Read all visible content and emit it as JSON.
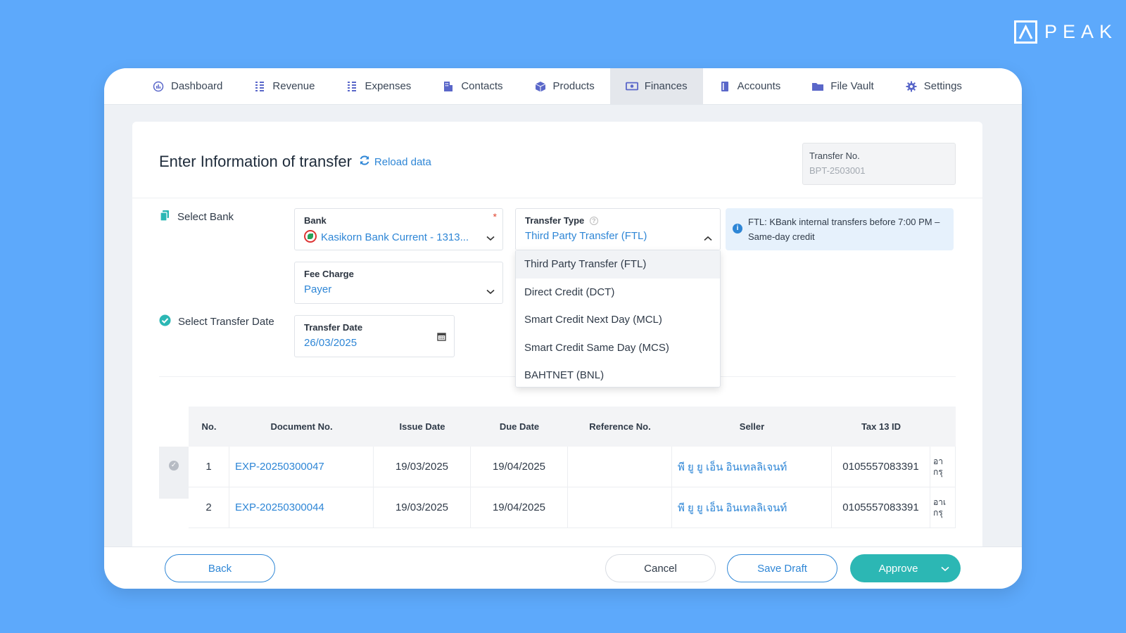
{
  "brand": {
    "name": "PEAK"
  },
  "nav": {
    "items": [
      {
        "label": "Dashboard",
        "icon": "dashboard-icon"
      },
      {
        "label": "Revenue",
        "icon": "revenue-icon"
      },
      {
        "label": "Expenses",
        "icon": "expenses-icon"
      },
      {
        "label": "Contacts",
        "icon": "contacts-icon"
      },
      {
        "label": "Products",
        "icon": "products-icon"
      },
      {
        "label": "Finances",
        "icon": "finances-icon",
        "active": true
      },
      {
        "label": "Accounts",
        "icon": "accounts-icon"
      },
      {
        "label": "File Vault",
        "icon": "folder-icon"
      },
      {
        "label": "Settings",
        "icon": "gear-icon"
      }
    ]
  },
  "header": {
    "title": "Enter Information of transfer",
    "reload_label": "Reload data",
    "transfer_no_label": "Transfer No.",
    "transfer_no_value": "BPT-2503001"
  },
  "form": {
    "select_bank_label": "Select Bank",
    "select_date_label": "Select Transfer Date",
    "bank": {
      "label": "Bank",
      "value": "Kasikorn Bank Current - 1313...",
      "required_mark": "*"
    },
    "transfer_type": {
      "label": "Transfer Type",
      "value": "Third Party Transfer (FTL)"
    },
    "fee_charge": {
      "label": "Fee Charge",
      "value": "Payer"
    },
    "transfer_date": {
      "label": "Transfer Date",
      "value": "26/03/2025"
    },
    "info_note": "FTL: KBank internal transfers before 7:00 PM – Same-day credit"
  },
  "dropdown": {
    "options": [
      "Third Party Transfer (FTL)",
      "Direct Credit (DCT)",
      "Smart Credit Next Day (MCL)",
      "Smart Credit Same Day (MCS)",
      "BAHTNET (BNL)"
    ],
    "selected_index": 0
  },
  "table": {
    "headers": [
      "No.",
      "Document No.",
      "Issue Date",
      "Due Date",
      "Reference No.",
      "Seller",
      "Tax 13 ID"
    ],
    "rows": [
      {
        "no": "1",
        "doc": "EXP-20250300047",
        "issue": "19/03/2025",
        "due": "19/04/2025",
        "ref": "",
        "seller": "พี ยู ยู เอ็น อินเทลลิเจนท์",
        "tax": "0105557083391",
        "more1": "อา",
        "more2": "กรุ"
      },
      {
        "no": "2",
        "doc": "EXP-20250300044",
        "issue": "19/03/2025",
        "due": "19/04/2025",
        "ref": "",
        "seller": "พี ยู ยู เอ็น อินเทลลิเจนท์",
        "tax": "0105557083391",
        "more1": "อาเ",
        "more2": "กรุ"
      }
    ]
  },
  "footer": {
    "back": "Back",
    "cancel": "Cancel",
    "save_draft": "Save Draft",
    "approve": "Approve"
  },
  "colors": {
    "accent": "#2e86d6",
    "approve": "#2cb7b4",
    "background": "#5da9fb"
  }
}
